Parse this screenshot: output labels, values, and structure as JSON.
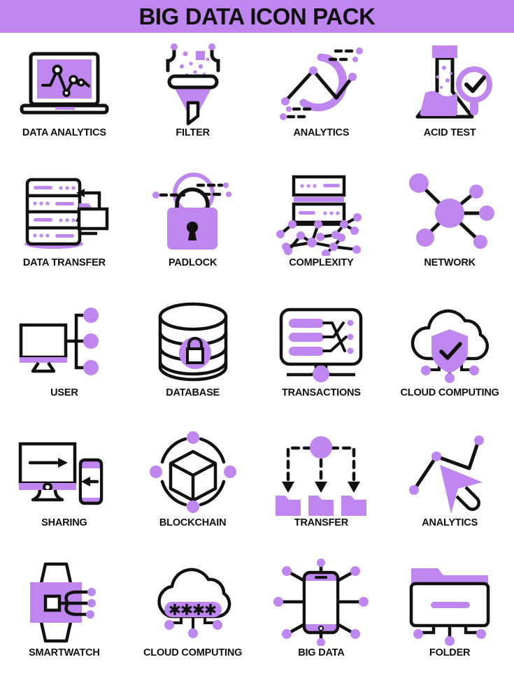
{
  "header": {
    "title": "BIG DATA ICON PACK",
    "banner_color": "#bf86ef"
  },
  "palette": {
    "purple": "#bf86ef",
    "purple_mid": "#b379e8",
    "ink": "#111111",
    "background": "#ffffff"
  },
  "grid": {
    "columns": 4,
    "rows": 5,
    "total_icons": 20
  },
  "icons": [
    {
      "label": "DATA ANALYTICS",
      "icon": "laptop-line-chart-icon"
    },
    {
      "label": "FILTER",
      "icon": "funnel-filter-icon"
    },
    {
      "label": "ANALYTICS",
      "icon": "donut-ring-line-chart-icon"
    },
    {
      "label": "ACID TEST",
      "icon": "flask-magnifier-check-icon"
    },
    {
      "label": "DATA TRANSFER",
      "icon": "server-rack-folder-arrows-icon"
    },
    {
      "label": "PADLOCK",
      "icon": "padlock-icon"
    },
    {
      "label": "COMPLEXITY",
      "icon": "servers-node-web-icon"
    },
    {
      "label": "NETWORK",
      "icon": "hub-nodes-icon"
    },
    {
      "label": "USER",
      "icon": "monitor-nodes-icon"
    },
    {
      "label": "DATABASE",
      "icon": "database-cylinder-lock-icon"
    },
    {
      "label": "TRANSACTIONS",
      "icon": "panel-crossing-wires-icon"
    },
    {
      "label": "CLOUD COMPUTING",
      "icon": "cloud-shield-check-icon"
    },
    {
      "label": "SHARING",
      "icon": "monitor-phone-arrows-icon"
    },
    {
      "label": "BLOCKCHAIN",
      "icon": "cube-orbit-nodes-icon"
    },
    {
      "label": "TRANSFER",
      "icon": "node-dashed-arrows-folders-icon"
    },
    {
      "label": "ANALYTICS",
      "icon": "cursor-line-chart-icon"
    },
    {
      "label": "SMARTWATCH",
      "icon": "smartwatch-icon"
    },
    {
      "label": "CLOUD COMPUTING",
      "icon": "cloud-password-icon"
    },
    {
      "label": "BIG DATA",
      "icon": "phone-radiating-nodes-icon"
    },
    {
      "label": "FOLDER",
      "icon": "folder-connectors-icon"
    }
  ]
}
